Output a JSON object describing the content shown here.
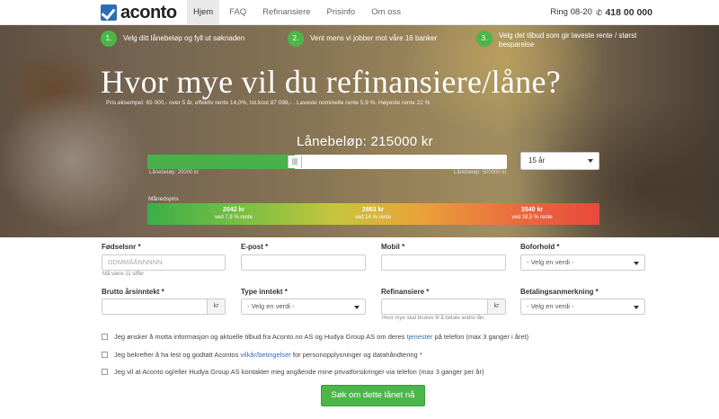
{
  "brand": {
    "logo_text": "aconto"
  },
  "nav": [
    {
      "label": "Hjem",
      "active": true
    },
    {
      "label": "FAQ",
      "active": false
    },
    {
      "label": "Refinansiere",
      "active": false
    },
    {
      "label": "Prisinfo",
      "active": false
    },
    {
      "label": "Om oss",
      "active": false
    }
  ],
  "contact": {
    "hours": "Ring 08-20",
    "phone": "418 00 000",
    "icon": "phone-icon"
  },
  "steps": [
    {
      "num": "1.",
      "text": "Velg ditt lånebeløp og fyll ut søknaden"
    },
    {
      "num": "2.",
      "text": "Vent mens vi jobber mot våre 16 banker"
    },
    {
      "num": "3.",
      "text_line1": "Velg det tilbud som gir laveste rente / størst",
      "text_line2": "besparelse"
    }
  ],
  "hero": {
    "headline": "Hvor mye vil du refinansiere/låne?",
    "fine_print": "Pris.eksempel: 65 000,- over 5 år, effektiv rente 14,0%, tot.kost 87 098,- . Laveste nominelle rente 5,9 %. Høyeste rente 22 %",
    "loan_label": "Lånebeløp: 215000 kr",
    "slider": {
      "value": 215000,
      "min": 20000,
      "max": 500000,
      "min_label": "Lånebeløp: 20000 kr",
      "max_label": "Lånebeløp: 500000 kr",
      "handle_glyph": "|||"
    },
    "years_selected": "15 år",
    "monthly_label": "Månedspris",
    "rates": [
      {
        "amount": "2042 kr",
        "label": "ved 7,9 % rente"
      },
      {
        "amount": "2863 kr",
        "label": "ved 14 % rente"
      },
      {
        "amount": "3540 kr",
        "label": "ved 18,5 % rente"
      }
    ]
  },
  "form": {
    "fodselsnr": {
      "label": "Fødselsnr *",
      "placeholder": "DDMMÅÅNNNNN",
      "help": "Må være 11 siffer"
    },
    "epost": {
      "label": "E-post *"
    },
    "mobil": {
      "label": "Mobil *"
    },
    "boforhold": {
      "label": "Boforhold *",
      "value": "- Velg en verdi -"
    },
    "brutto": {
      "label": "Brutto årsinntekt *",
      "addon": "kr"
    },
    "type_inntekt": {
      "label": "Type inntekt *",
      "value": "- Velg en verdi -"
    },
    "refinansiere": {
      "label": "Refinansiere *",
      "addon": "kr",
      "help": "Hvor mye skal brukes til å betale andre lån."
    },
    "betalingsanmerkning": {
      "label": "Betalingsanmerkning *",
      "value": "- Velg en verdi -"
    },
    "consents": [
      {
        "before": "Jeg ønsker å motta informasjon og aktuelle tilbud fra Aconto.no AS og Hudya Group AS om deres ",
        "link": "tjenester",
        "after": " på telefon (max 3 ganger i året)"
      },
      {
        "before": "Jeg bekrefter å ha lest og godtatt Acontos ",
        "link": "vilkår/betingelser",
        "after": " for personopplysninger og datahåndtering *"
      },
      {
        "text": "Jeg vil at Aconto og/eller Hudya Group AS kontakter meg angående mine privatforsikringer via telefon (max 3 ganger per år)"
      }
    ],
    "submit_label": "Søk om dette lånet nå"
  },
  "colors": {
    "green": "#4cb649",
    "brand_blue": "#2d6db5",
    "rate_low": "#3cae4a",
    "rate_high": "#e84a3d"
  }
}
